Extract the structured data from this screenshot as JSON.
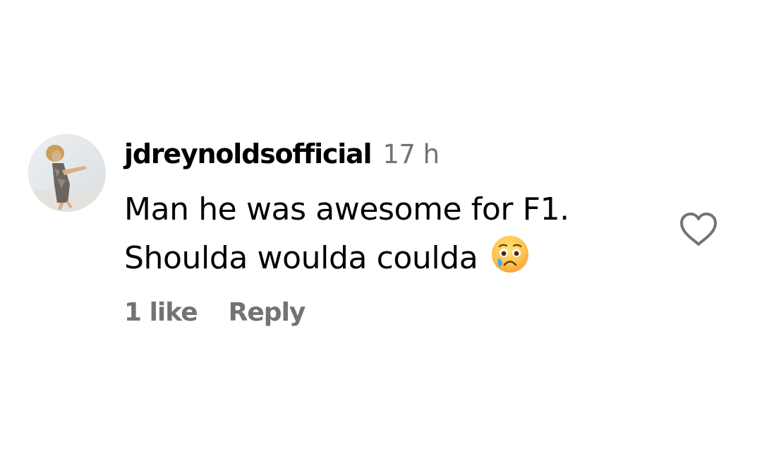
{
  "comment": {
    "username": "jdreynoldsofficial",
    "timestamp": "17 h",
    "text_lines": [
      "Man he was awesome for F1.",
      "Shoulda woulda coulda"
    ],
    "emoji": "crying-face",
    "likes_label": "1 like",
    "reply_label": "Reply"
  },
  "icons": {
    "like": "heart-outline-icon",
    "avatar": "profile-photo"
  },
  "colors": {
    "primary_text": "#000000",
    "secondary_text": "#737373",
    "background": "#ffffff"
  }
}
